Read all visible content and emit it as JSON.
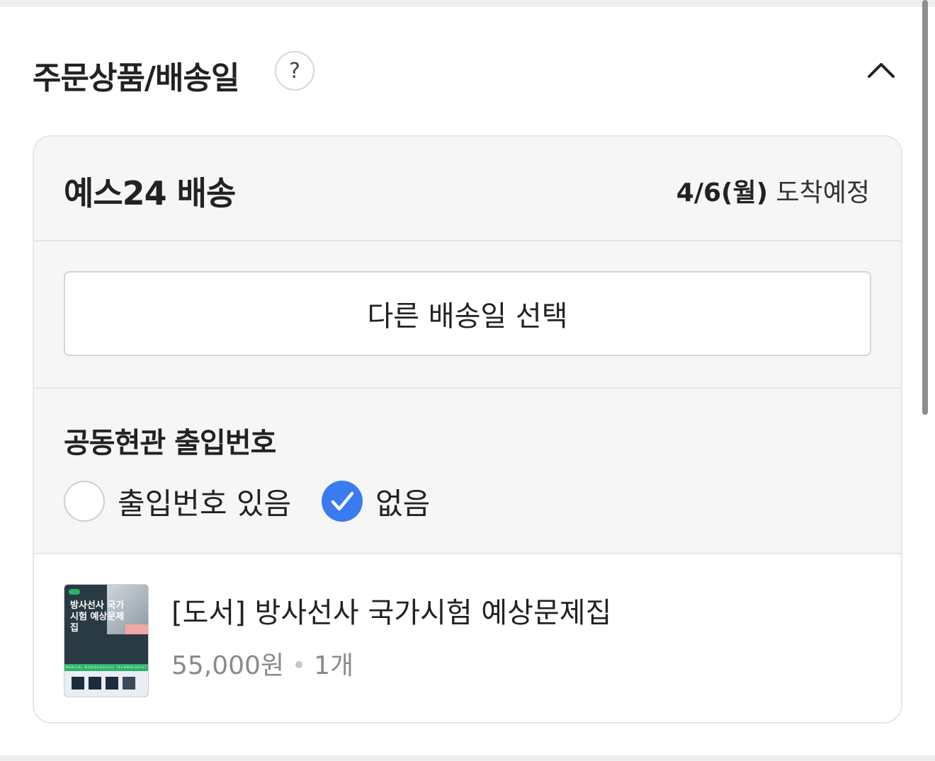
{
  "section": {
    "title": "주문상품/배송일",
    "help_icon": "?",
    "collapse_icon": "chevron-up-icon"
  },
  "delivery": {
    "shipper": "예스24 배송",
    "arrival_date": "4/6(월)",
    "arrival_suffix": " 도착예정",
    "other_date_button": "다른 배송일 선택"
  },
  "entry_code": {
    "title": "공동현관 출입번호",
    "options": [
      {
        "label": "출입번호 있음",
        "selected": false
      },
      {
        "label": "없음",
        "selected": true
      }
    ]
  },
  "item": {
    "title": "[도서] 방사선사 국가시험 예상문제집",
    "price": "55,000원",
    "quantity": "1개",
    "cover": {
      "title": "방사선사 국가시험 예상문제집",
      "band_text": "MEDICAL RADIOLOGICAL TECHNOLOGIST"
    }
  },
  "colors": {
    "accent": "#3a7bf0",
    "card_bg": "#f6f6f6",
    "border": "#e6e6e6"
  }
}
